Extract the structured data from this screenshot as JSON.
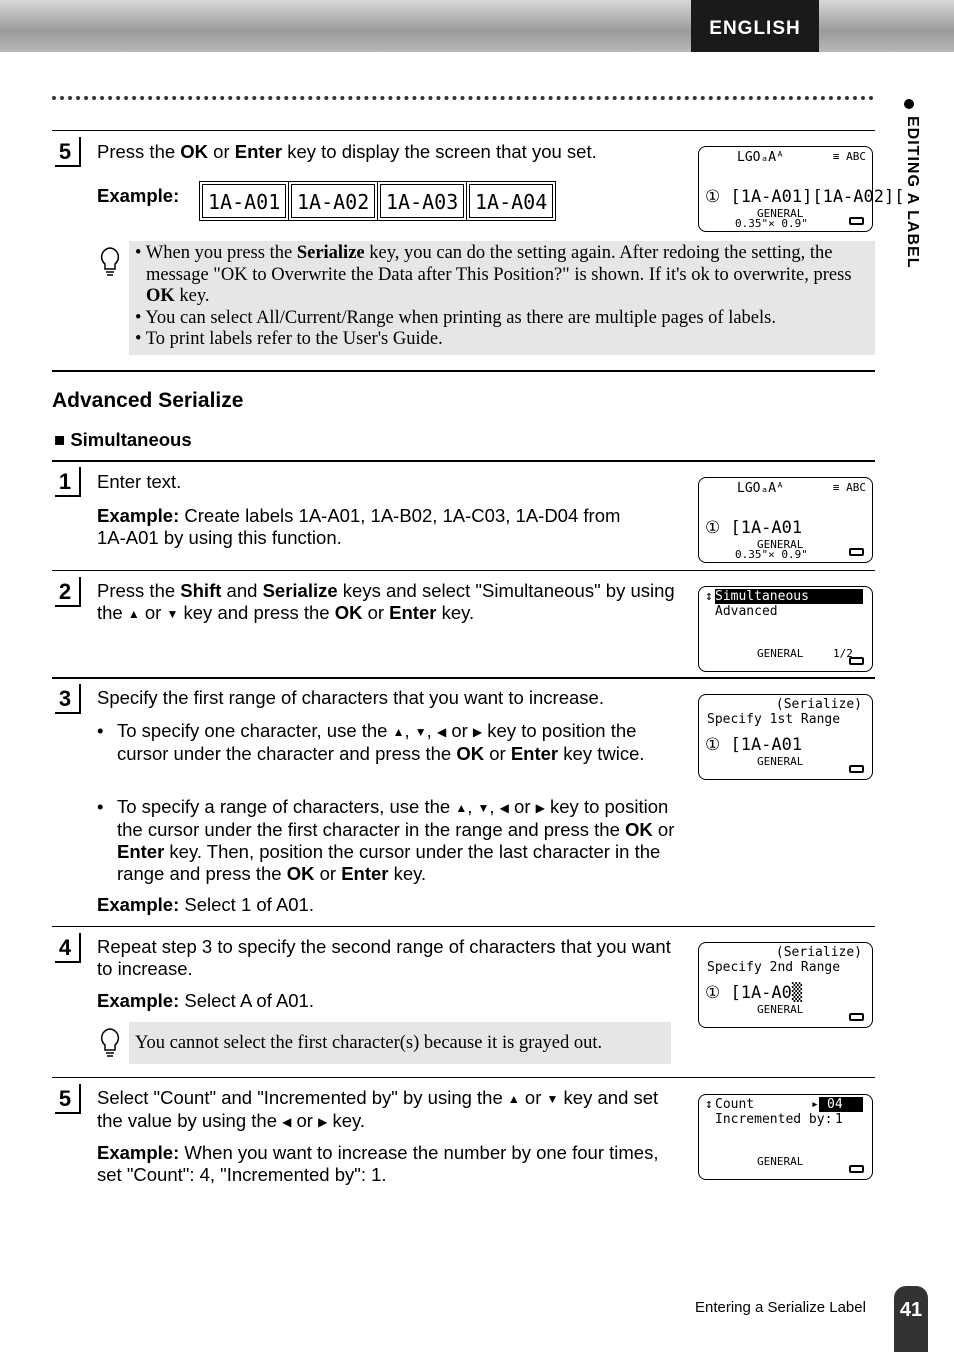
{
  "header": {
    "language": "ENGLISH"
  },
  "side_tab": "EDITING A LABEL",
  "step5a": {
    "num": "5",
    "text_pre": "Press the ",
    "ok": "OK",
    "or": " or ",
    "enter": "Enter",
    "text_post": " key to display the screen that you set.",
    "example_label": "Example:",
    "examples": [
      "1A-A01",
      "1A-A02",
      "1A-A03",
      "1A-A04"
    ],
    "lcd": {
      "top": "LGOₐAᴬ",
      "icons": "≡ ABC",
      "line": "① [1A-A01][1A-A02][",
      "general": "GENERAL",
      "size": "0.35\"× 0.9\""
    },
    "notes": [
      "• When you press the ",
      "Serialize",
      " key, you can do the setting again. After redoing the setting, the message \"OK to Overwrite the Data after This Position?\" is shown. If it's ok to overwrite, press ",
      "OK",
      " key.",
      "• You can select All/Current/Range when printing as there are multiple pages of labels.",
      "• To print labels refer to the User's Guide."
    ]
  },
  "section_title": "Advanced Serialize",
  "subsection_title": "Simultaneous",
  "step1": {
    "num": "1",
    "text": "Enter text.",
    "example_label": "Example:",
    "example_text": " Create labels 1A-A01, 1A-B02, 1A-C03, 1A-D04 from 1A-A01 by using this function.",
    "lcd": {
      "top": "LGOₐAᴬ",
      "icons": "≡ ABC",
      "line": "① [1A-A01",
      "general": "GENERAL",
      "size": "0.35\"× 0.9\""
    }
  },
  "step2": {
    "num": "2",
    "parts": [
      "Press the ",
      "Shift",
      " and ",
      "Serialize",
      " keys and select \"Simultaneous\" by using the ",
      "▲",
      " or ",
      "▼",
      " key and press the ",
      "OK",
      " or ",
      "Enter",
      " key."
    ],
    "lcd": {
      "item1": "Simultaneous",
      "item2": "Advanced",
      "general": "GENERAL",
      "page": "1/2"
    }
  },
  "step3": {
    "num": "3",
    "text": "Specify the first range of characters that you want to increase.",
    "bullet1": [
      "To specify one character, use the ",
      "▲",
      ", ",
      "▼",
      ", ",
      "◀",
      " or ",
      "▶",
      " key to position the cursor under the character and press the ",
      "OK",
      " or ",
      "Enter",
      " key twice."
    ],
    "bullet2": [
      "To specify a range of characters, use the ",
      "▲",
      ", ",
      "▼",
      ", ",
      "◀",
      " or ",
      "▶",
      " key to position the cursor under the first character in the range and press the ",
      "OK",
      " or ",
      "Enter",
      " key. Then, position the cursor under the last character in the range and press the ",
      "OK",
      " or ",
      "Enter",
      " key."
    ],
    "example_label": "Example:",
    "example_text": " Select 1 of A01.",
    "lcd": {
      "mode": "(Serialize)",
      "prompt": "Specify 1st Range",
      "line": "① [1A-A01",
      "general": "GENERAL"
    }
  },
  "step4": {
    "num": "4",
    "text": "Repeat step 3 to specify the second range of characters that you want to increase.",
    "example_label": "Example:",
    "example_text": " Select A of A01.",
    "note": "You cannot select the first character(s) because it is grayed out.",
    "lcd": {
      "mode": "(Serialize)",
      "prompt": "Specify 2nd Range",
      "line": "① [1A-A0▒",
      "general": "GENERAL"
    }
  },
  "step5b": {
    "num": "5",
    "parts": [
      "Select \"Count\" and \"Incremented by\" by using the ",
      "▲",
      " or ",
      "▼",
      " key and set the value by using the ",
      "◀",
      " or ",
      "▶",
      " key."
    ],
    "example_label": "Example:",
    "example_text": " When you want to increase the number by one four times, set \"Count\": 4, \"Incremented by\": 1.",
    "lcd": {
      "label1": "Count",
      "value1": "04",
      "label2": "Incremented by:",
      "value2": "1",
      "general": "GENERAL"
    }
  },
  "footer": {
    "text": "Entering a Serialize Label",
    "page": "41"
  }
}
